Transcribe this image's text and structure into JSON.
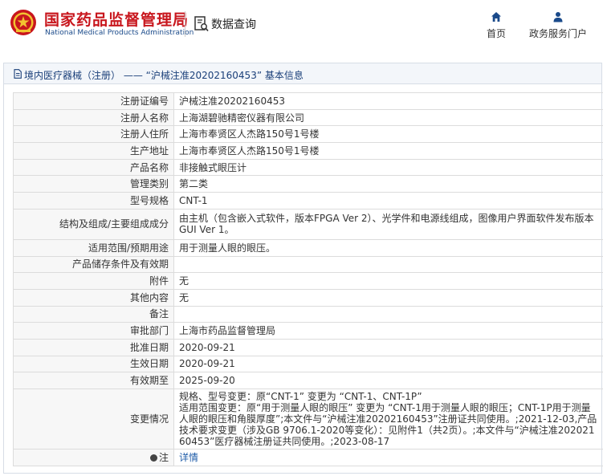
{
  "header": {
    "brand_cn": "国家药品监督管理局",
    "brand_en": "National Medical Products Administration",
    "search_title": "数据查询",
    "nav": [
      {
        "label": "首页",
        "icon": "home-icon"
      },
      {
        "label": "政务服务门户",
        "icon": "user-icon"
      }
    ],
    "brand_color": "#c8161d",
    "nav_color": "#1a4a8a"
  },
  "panel": {
    "title": "境内医疗器械（注册） —— “沪械注准20202160453” 基本信息",
    "title_color": "#1a3f79"
  },
  "rows": [
    {
      "label": "注册证编号",
      "value": "沪械注准20202160453"
    },
    {
      "label": "注册人名称",
      "value": "上海湖碧驰精密仪器有限公司"
    },
    {
      "label": "注册人住所",
      "value": "上海市奉贤区人杰路150号1号楼"
    },
    {
      "label": "生产地址",
      "value": "上海市奉贤区人杰路150号1号楼"
    },
    {
      "label": "产品名称",
      "value": "非接触式眼压计"
    },
    {
      "label": "管理类别",
      "value": "第二类"
    },
    {
      "label": "型号规格",
      "value": "CNT-1"
    },
    {
      "label": "结构及组成/主要组成成分",
      "value": "由主机（包含嵌入式软件，版本FPGA Ver 2）、光学件和电源线组成，图像用户界面软件发布版本GUI Ver 1。"
    },
    {
      "label": "适用范围/预期用途",
      "value": "用于测量人眼的眼压。"
    },
    {
      "label": "产品储存条件及有效期",
      "value": ""
    },
    {
      "label": "附件",
      "value": "无"
    },
    {
      "label": "其他内容",
      "value": "无"
    },
    {
      "label": "备注",
      "value": ""
    },
    {
      "label": "审批部门",
      "value": "上海市药品监督管理局"
    },
    {
      "label": "批准日期",
      "value": "2020-09-21"
    },
    {
      "label": "生效日期",
      "value": "2020-09-21"
    },
    {
      "label": "有效期至",
      "value": "2025-09-20"
    },
    {
      "label": "变更情况",
      "value": "规格、型号变更：原“CNT-1” 变更为 “CNT-1、CNT-1P”\n适用范围变更：原“用于测量人眼的眼压” 变更为 “CNT-1用于测量人眼的眼压；CNT-1P用于测量人眼的眼压和角膜厚度”;本文件与“沪械注准20202160453”注册证共同使用。;2021-12-03,产品技术要求变更（涉及GB 9706.1-2020等变化）：见附件1（共2页）。;本文件与“沪械注准20202160453”医疗器械注册证共同使用。;2023-08-17"
    },
    {
      "label": "注",
      "value": "详情"
    }
  ]
}
